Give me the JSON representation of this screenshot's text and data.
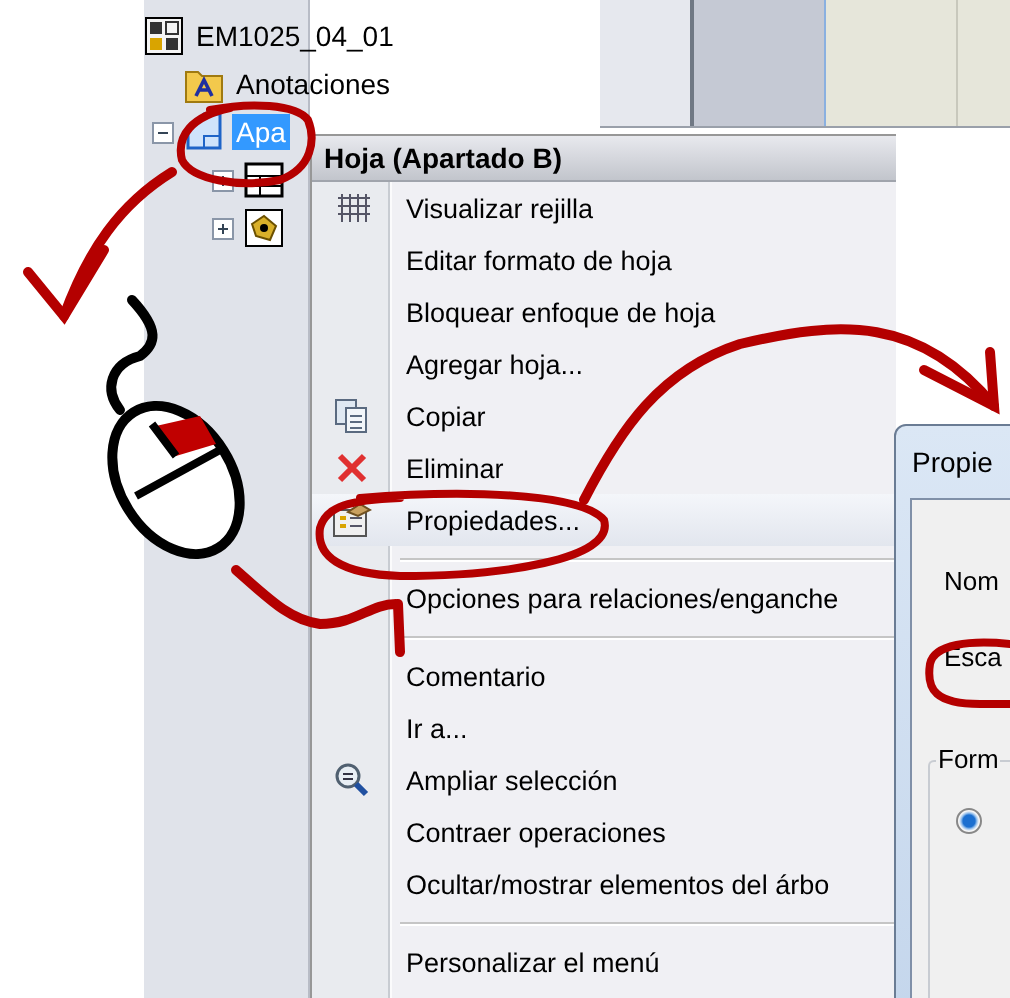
{
  "tree": {
    "label": "EM1025_04_01",
    "children": [
      {
        "label": "Anotaciones",
        "kind": "annotations",
        "selected": false
      },
      {
        "label": "Apa",
        "kind": "sheet",
        "expanded": true,
        "selected": true,
        "children": [
          {
            "kind": "sheet-format",
            "expanded": false
          },
          {
            "kind": "view",
            "expanded": false
          }
        ]
      }
    ]
  },
  "menu": {
    "title": "Hoja (Apartado B)",
    "items": [
      {
        "kind": "grid",
        "label": "Visualizar rejilla",
        "selected": false
      },
      {
        "kind": "plain",
        "label": "Editar formato de hoja",
        "selected": false
      },
      {
        "kind": "plain",
        "label": "Bloquear enfoque de hoja",
        "selected": false
      },
      {
        "kind": "plain",
        "label": "Agregar hoja...",
        "selected": false
      },
      {
        "kind": "copy",
        "label": "Copiar",
        "selected": false
      },
      {
        "kind": "delete",
        "label": "Eliminar",
        "selected": false
      },
      {
        "kind": "properties",
        "label": "Propiedades...",
        "selected": true
      },
      {
        "kind": "separator"
      },
      {
        "kind": "plain",
        "label": "Opciones para relaciones/enganche",
        "selected": false
      },
      {
        "kind": "separator"
      },
      {
        "kind": "plain",
        "label": "Comentario",
        "selected": false
      },
      {
        "kind": "plain",
        "label": "Ir a...",
        "selected": false
      },
      {
        "kind": "zoom",
        "label": "Ampliar selección",
        "selected": false
      },
      {
        "kind": "plain",
        "label": "Contraer operaciones",
        "selected": false
      },
      {
        "kind": "plain",
        "label": "Ocultar/mostrar elementos del árbo",
        "selected": false
      },
      {
        "kind": "separator"
      },
      {
        "kind": "plain",
        "label": "Personalizar el menú",
        "selected": false
      }
    ]
  },
  "dialog": {
    "title": "Propie",
    "fields": [
      {
        "label": "Nom"
      },
      {
        "label": "Esca"
      }
    ],
    "group": {
      "title": "Form",
      "radios": [
        {
          "selected": true
        }
      ]
    }
  }
}
